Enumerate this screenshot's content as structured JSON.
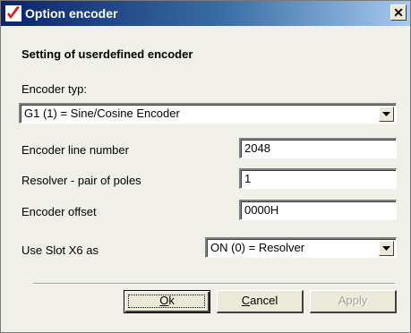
{
  "window": {
    "title": "Option encoder",
    "close_glyph": "✕"
  },
  "dialog": {
    "heading": "Setting of userdefined encoder",
    "encoder_type": {
      "label": "Encoder typ:",
      "selected": "G1 (1) = Sine/Cosine Encoder"
    },
    "line_number": {
      "label": "Encoder line number",
      "value": "2048"
    },
    "pole_pairs": {
      "label": "Resolver - pair of poles",
      "value": "1"
    },
    "offset": {
      "label": "Encoder offset",
      "value": "0000H"
    },
    "slot_x6": {
      "label": "Use Slot X6 as",
      "selected": "ON (0) = Resolver"
    }
  },
  "buttons": {
    "ok": {
      "mnemonic": "O",
      "rest": "k"
    },
    "cancel": {
      "mnemonic": "C",
      "rest": "ancel"
    },
    "apply": {
      "label": "Apply",
      "enabled": false
    }
  },
  "icons": {
    "app": "checkmark-icon",
    "close": "close-icon",
    "dropdown": "chevron-down-icon"
  },
  "colors": {
    "titlebar_start": "#0a246a",
    "titlebar_end": "#a6caf0",
    "dialog_bg": "#f0efe8",
    "app_icon_red": "#d42020"
  }
}
